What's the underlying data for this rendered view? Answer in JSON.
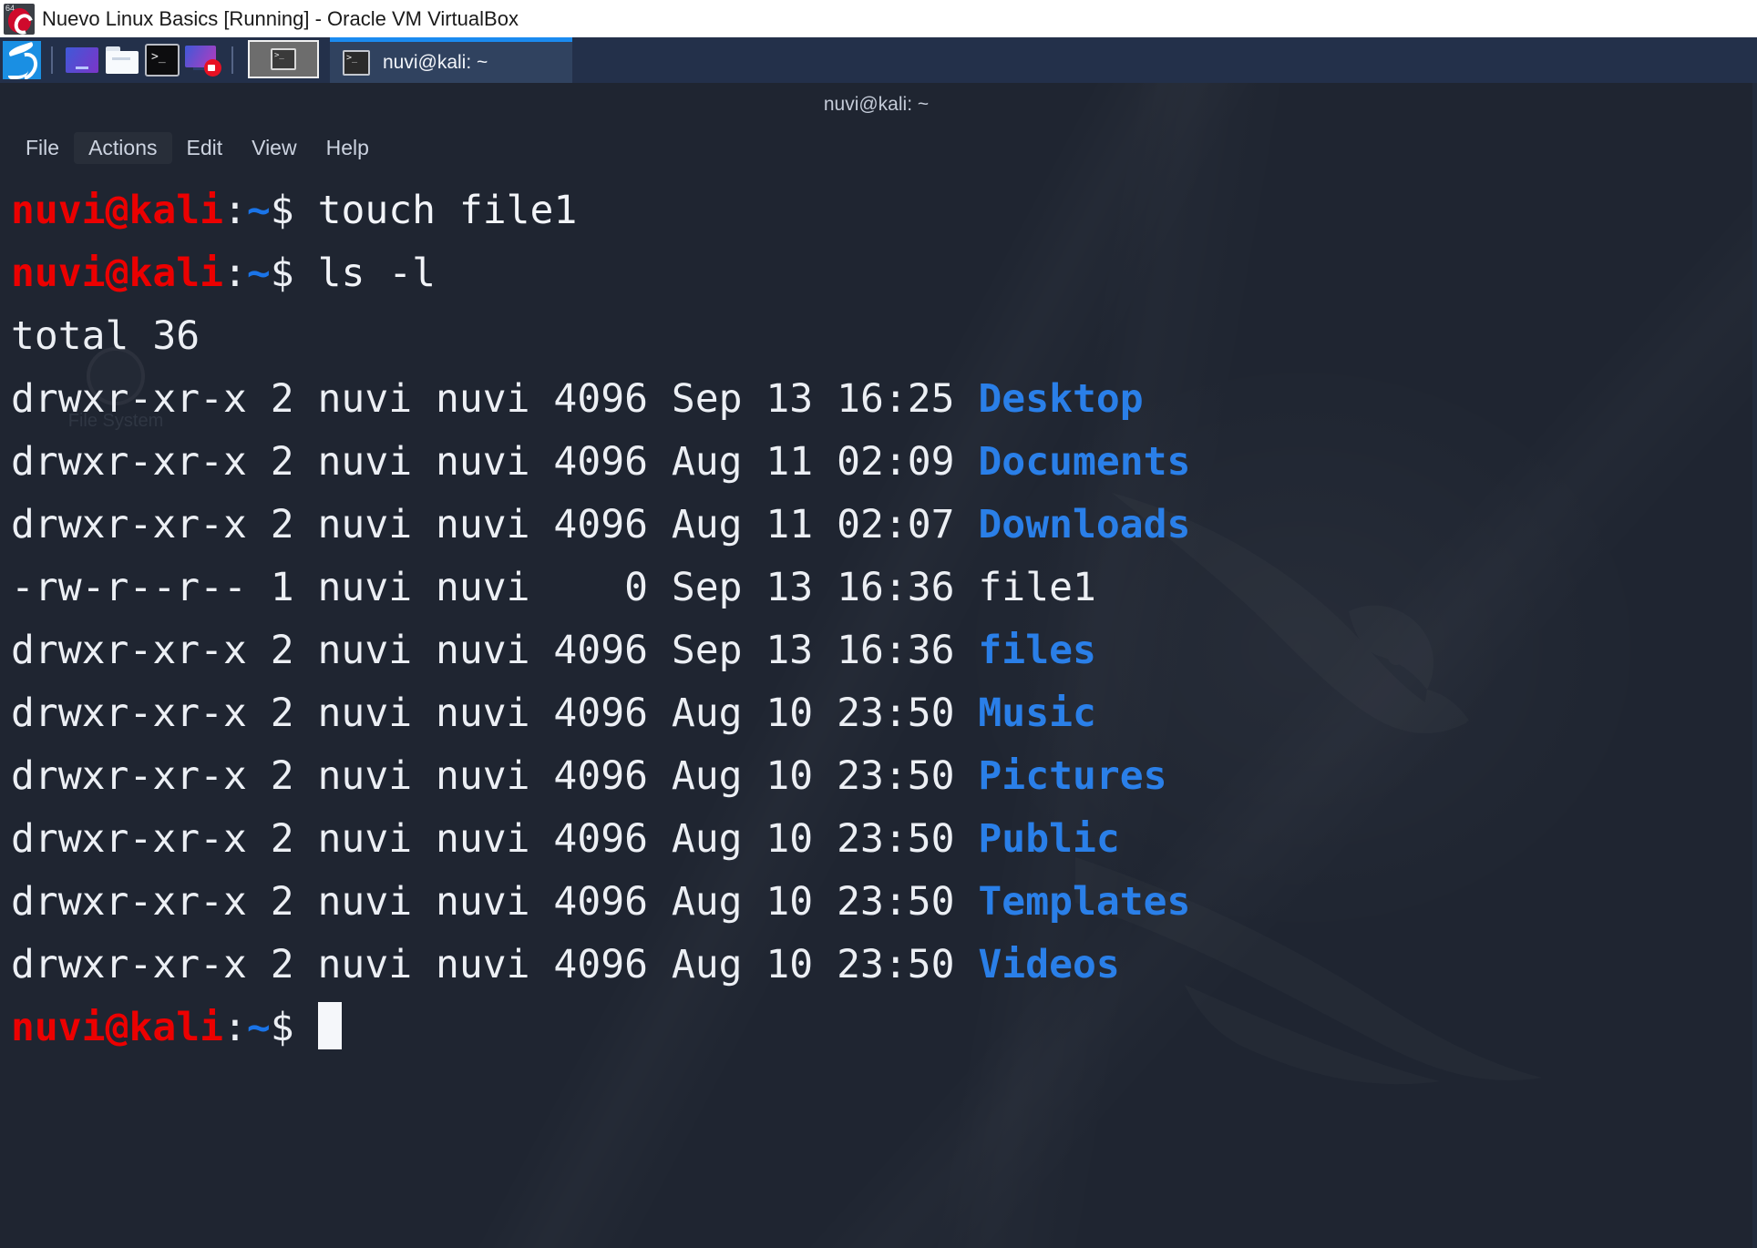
{
  "vbox": {
    "title": "Nuevo Linux Basics [Running] - Oracle VM VirtualBox",
    "icon": "virtualbox-icon",
    "icon_badge": "64"
  },
  "panel": {
    "launchers": [
      {
        "name": "kali-menu-icon",
        "label": "Kali Menu"
      },
      {
        "name": "web-browser-icon",
        "label": "Web Browser"
      },
      {
        "name": "file-manager-icon",
        "label": "File Manager"
      },
      {
        "name": "terminal-icon",
        "label": "Terminal"
      },
      {
        "name": "screen-recorder-icon",
        "label": "Screen Recorder"
      }
    ],
    "workspace": {
      "name": "workspace-switcher",
      "label": "Workspace 1"
    },
    "tasks": [
      {
        "name": "taskbar-window-terminal",
        "label": "nuvi@kali: ~",
        "active": true
      }
    ]
  },
  "terminal": {
    "window_title": "nuvi@kali: ~",
    "menus": [
      "File",
      "Actions",
      "Edit",
      "View",
      "Help"
    ],
    "desktop_icon_label": "File System",
    "colors": {
      "background": "#1f2531",
      "foreground": "#eceff4",
      "prompt_user": "#ec0000",
      "prompt_path": "#1a74e8",
      "directory": "#2a7fe8",
      "panel": "#23304a",
      "accent": "#1b8bf0"
    },
    "prompt": {
      "user_host": "nuvi@kali",
      "colon": ":",
      "path": "~",
      "sigil": "$"
    },
    "lines": [
      {
        "type": "prompt",
        "command": "touch file1"
      },
      {
        "type": "prompt",
        "command": "ls -l"
      },
      {
        "type": "output",
        "text": "total 36"
      },
      {
        "type": "entry",
        "perms": "drwxr-xr-x",
        "links": "2",
        "owner": "nuvi",
        "group": "nuvi",
        "size": "4096",
        "month": "Sep",
        "day": "13",
        "time": "16:25",
        "name": "Desktop",
        "kind": "dir"
      },
      {
        "type": "entry",
        "perms": "drwxr-xr-x",
        "links": "2",
        "owner": "nuvi",
        "group": "nuvi",
        "size": "4096",
        "month": "Aug",
        "day": "11",
        "time": "02:09",
        "name": "Documents",
        "kind": "dir"
      },
      {
        "type": "entry",
        "perms": "drwxr-xr-x",
        "links": "2",
        "owner": "nuvi",
        "group": "nuvi",
        "size": "4096",
        "month": "Aug",
        "day": "11",
        "time": "02:07",
        "name": "Downloads",
        "kind": "dir"
      },
      {
        "type": "entry",
        "perms": "-rw-r--r--",
        "links": "1",
        "owner": "nuvi",
        "group": "nuvi",
        "size": "0",
        "month": "Sep",
        "day": "13",
        "time": "16:36",
        "name": "file1",
        "kind": "file"
      },
      {
        "type": "entry",
        "perms": "drwxr-xr-x",
        "links": "2",
        "owner": "nuvi",
        "group": "nuvi",
        "size": "4096",
        "month": "Sep",
        "day": "13",
        "time": "16:36",
        "name": "files",
        "kind": "dir"
      },
      {
        "type": "entry",
        "perms": "drwxr-xr-x",
        "links": "2",
        "owner": "nuvi",
        "group": "nuvi",
        "size": "4096",
        "month": "Aug",
        "day": "10",
        "time": "23:50",
        "name": "Music",
        "kind": "dir"
      },
      {
        "type": "entry",
        "perms": "drwxr-xr-x",
        "links": "2",
        "owner": "nuvi",
        "group": "nuvi",
        "size": "4096",
        "month": "Aug",
        "day": "10",
        "time": "23:50",
        "name": "Pictures",
        "kind": "dir"
      },
      {
        "type": "entry",
        "perms": "drwxr-xr-x",
        "links": "2",
        "owner": "nuvi",
        "group": "nuvi",
        "size": "4096",
        "month": "Aug",
        "day": "10",
        "time": "23:50",
        "name": "Public",
        "kind": "dir"
      },
      {
        "type": "entry",
        "perms": "drwxr-xr-x",
        "links": "2",
        "owner": "nuvi",
        "group": "nuvi",
        "size": "4096",
        "month": "Aug",
        "day": "10",
        "time": "23:50",
        "name": "Templates",
        "kind": "dir"
      },
      {
        "type": "entry",
        "perms": "drwxr-xr-x",
        "links": "2",
        "owner": "nuvi",
        "group": "nuvi",
        "size": "4096",
        "month": "Aug",
        "day": "10",
        "time": "23:50",
        "name": "Videos",
        "kind": "dir"
      },
      {
        "type": "prompt",
        "command": "",
        "cursor": true
      }
    ]
  }
}
